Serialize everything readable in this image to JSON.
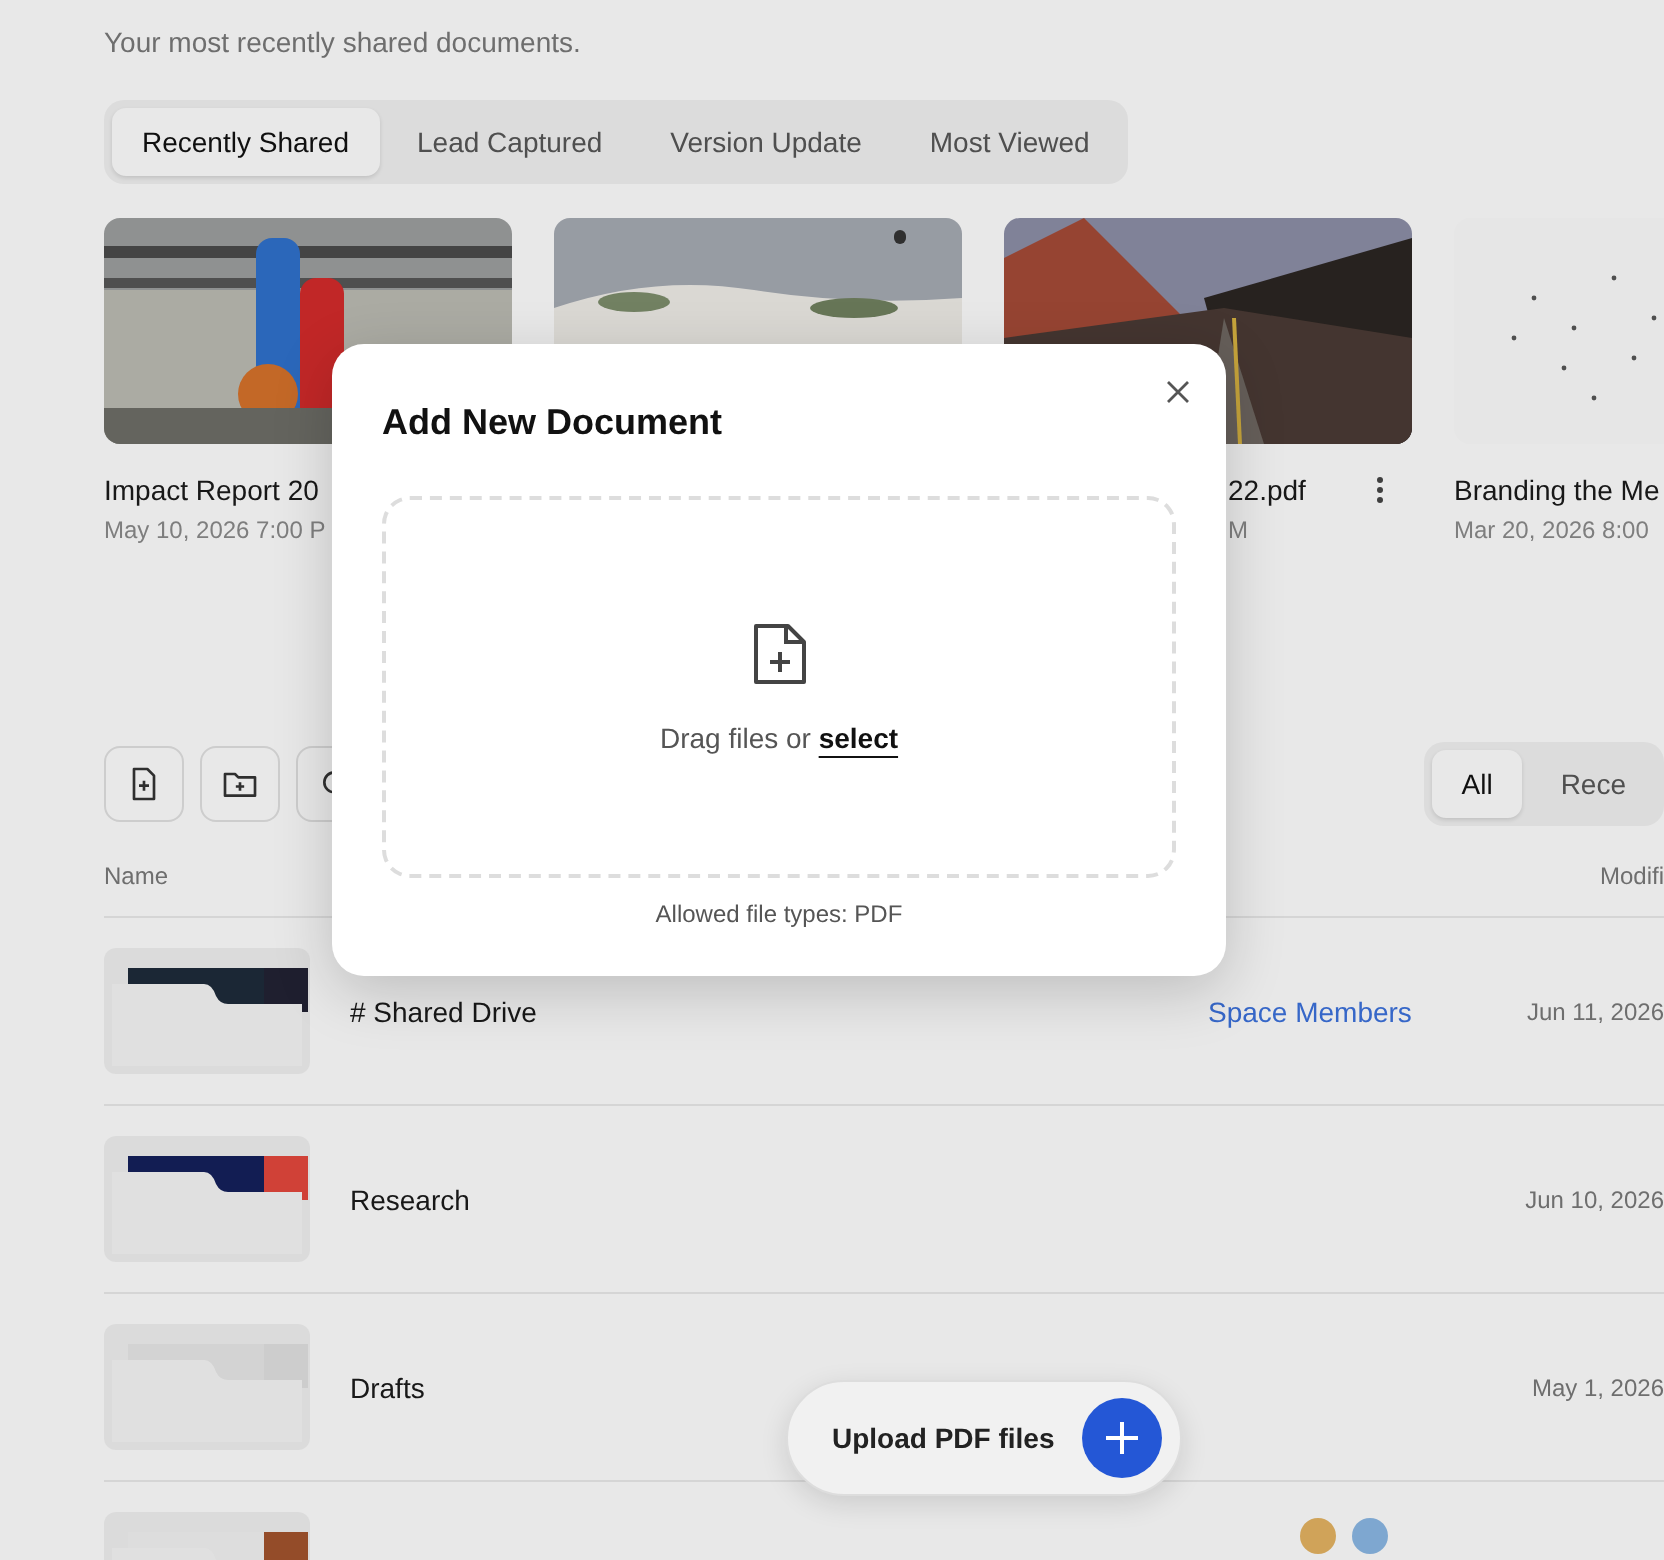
{
  "header": {
    "subtitle": "Your most recently shared documents."
  },
  "tabs": [
    {
      "label": "Recently Shared",
      "selected": true
    },
    {
      "label": "Lead Captured",
      "selected": false
    },
    {
      "label": "Version Update",
      "selected": false
    },
    {
      "label": "Most Viewed",
      "selected": false
    }
  ],
  "recent_documents": [
    {
      "title": "Impact Report 20",
      "date": "May 10, 2026 7:00 P",
      "menu_visible": false
    },
    {
      "menu_visible": false
    },
    {
      "title": "22.pdf",
      "date": "M",
      "menu_visible": true
    },
    {
      "title": "Branding the Me",
      "date": "Mar 20, 2026 8:00",
      "menu_visible": false
    }
  ],
  "toolbar": [
    {
      "kind": "new-document"
    },
    {
      "kind": "new-folder"
    },
    {
      "kind": "search"
    }
  ],
  "filters": [
    {
      "label": "All",
      "selected": true
    },
    {
      "label": "Rece",
      "selected": false
    }
  ],
  "table": {
    "columns": [
      "Name",
      "Modifi"
    ],
    "rows": [
      {
        "name": "# Shared Drive",
        "shared_with": "Space Members",
        "modified": "Jun 11, 2026",
        "member_avatars": false
      },
      {
        "name": "Research",
        "modified": "Jun 10, 2026",
        "member_avatars": false
      },
      {
        "name": "Drafts",
        "modified": "May 1, 2026",
        "member_avatars": false
      },
      {
        "member_avatars": true
      }
    ]
  },
  "modal": {
    "title": "Add New Document",
    "drop_text": "Drag files or",
    "select_link": "select",
    "note": "Allowed file types: PDF"
  },
  "upload_button": {
    "label": "Upload PDF files"
  }
}
